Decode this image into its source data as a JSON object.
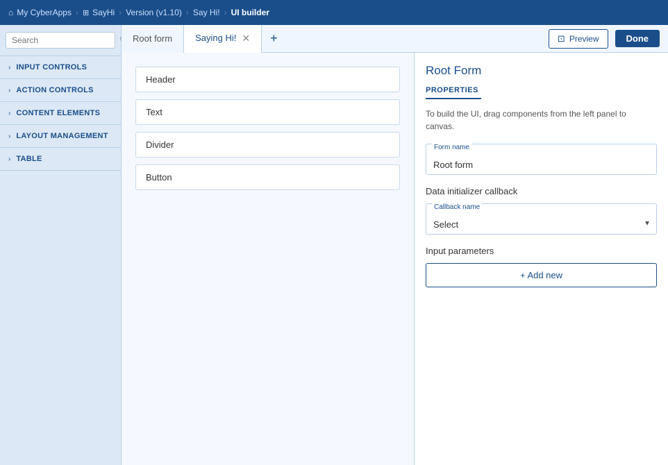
{
  "topbar": {
    "items": [
      {
        "label": "My CyberApps",
        "icon": "home-icon",
        "active": false
      },
      {
        "label": "SayHi",
        "icon": "grid-icon",
        "active": false
      },
      {
        "label": "Version (v1.10)",
        "active": false
      },
      {
        "label": "Say Hi!",
        "active": false
      },
      {
        "label": "UI builder",
        "active": true
      }
    ]
  },
  "sidebar": {
    "search_placeholder": "Search",
    "sections": [
      {
        "label": "INPUT CONTROLS"
      },
      {
        "label": "ACTION CONTROLS"
      },
      {
        "label": "CONTENT ELEMENTS"
      },
      {
        "label": "LAYOUT MANAGEMENT"
      },
      {
        "label": "TABLE"
      }
    ]
  },
  "tabs": [
    {
      "label": "Root form",
      "active": false,
      "closeable": false
    },
    {
      "label": "Saying Hi!",
      "active": true,
      "closeable": true
    }
  ],
  "toolbar": {
    "preview_label": "Preview",
    "done_label": "Done"
  },
  "canvas": {
    "elements": [
      {
        "label": "Header"
      },
      {
        "label": "Text"
      },
      {
        "label": "Divider"
      },
      {
        "label": "Button"
      }
    ]
  },
  "properties": {
    "title": "Root Form",
    "section_label": "PROPERTIES",
    "description": "To build the UI, drag components from the left panel to canvas.",
    "form_name_label": "Form name",
    "form_name_value": "Root form",
    "data_initializer_label": "Data initializer callback",
    "callback_name_label": "Callback name",
    "callback_name_value": "Select",
    "input_params_label": "Input parameters",
    "add_new_label": "+ Add new"
  }
}
